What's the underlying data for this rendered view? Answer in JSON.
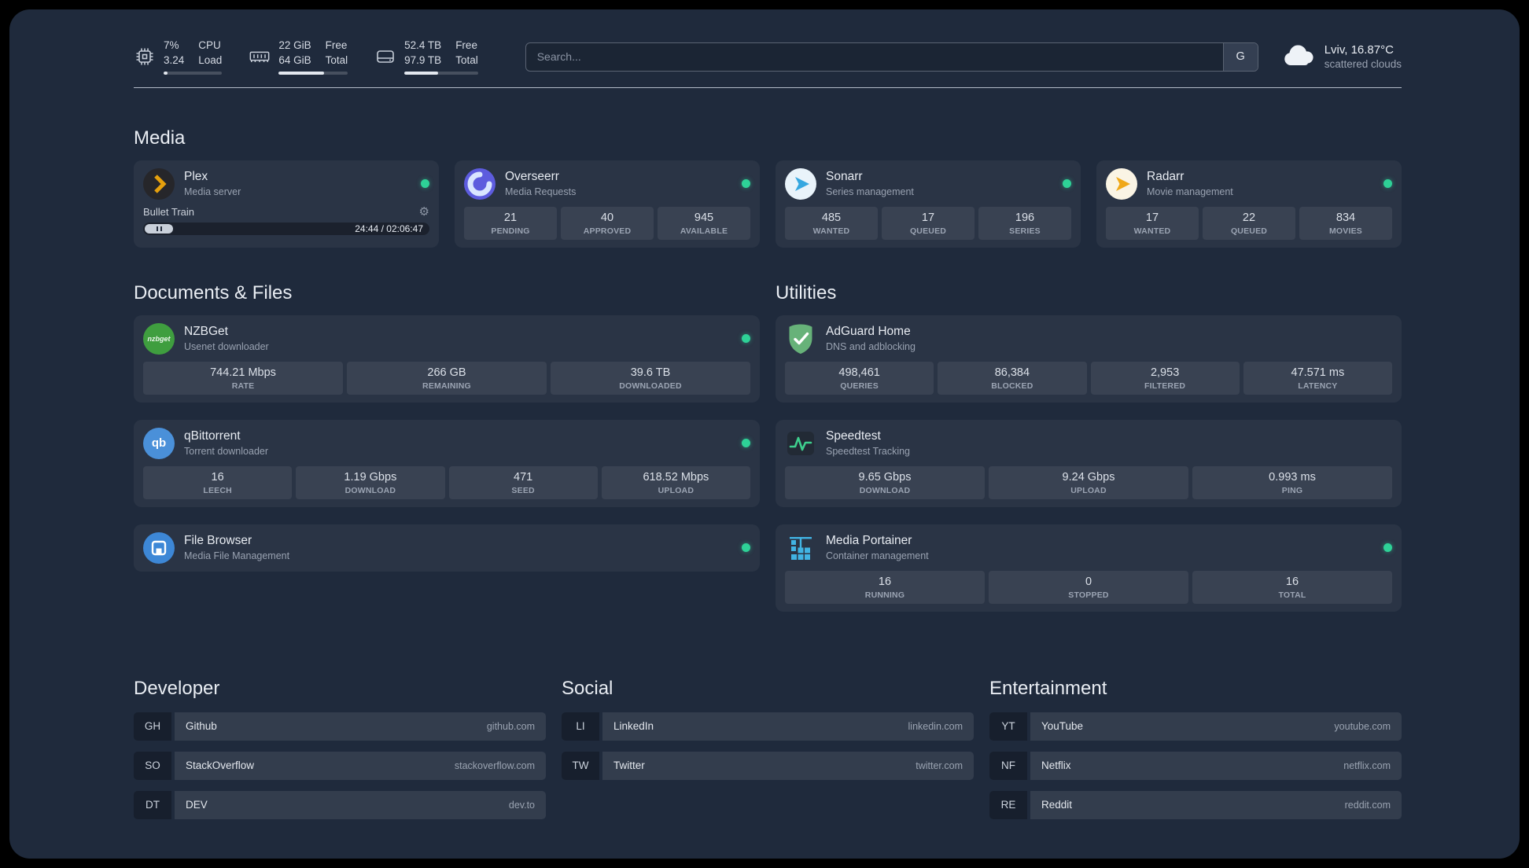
{
  "colors": {
    "background": "#1f2a3c",
    "status_online": "#2ed197",
    "plex_amber": "#e5a00d",
    "overseerr_purple": "#5d5cde",
    "sonarr_blue": "#35a7e0",
    "radarr_amber": "#f7b500",
    "nzbget_green": "#3f9e3f",
    "qbittorrent_blue": "#4a90d9",
    "adguard_green": "#67b279",
    "speedtest_green": "#3ecf8e",
    "filebrowser_blue": "#3d87d6",
    "portainer_blue": "#41b3e3"
  },
  "topbar": {
    "resources": [
      {
        "icon": "cpu-icon",
        "values": [
          "7%",
          "3.24"
        ],
        "labels": [
          "CPU",
          "Load"
        ],
        "bar_width": "7%"
      },
      {
        "icon": "memory-icon",
        "values": [
          "22 GiB",
          "64 GiB"
        ],
        "labels": [
          "Free",
          "Total"
        ],
        "bar_width": "66%"
      },
      {
        "icon": "disk-icon",
        "values": [
          "52.4 TB",
          "97.9 TB"
        ],
        "labels": [
          "Free",
          "Total"
        ],
        "bar_width": "46%"
      }
    ],
    "search": {
      "placeholder": "Search...",
      "provider_button": "G"
    },
    "weather": {
      "location": "Lviv, 16.87°C",
      "condition": "scattered clouds"
    }
  },
  "sections": {
    "media": {
      "title": "Media",
      "services": [
        {
          "name": "Plex",
          "description": "Media server",
          "icon": "plex-icon",
          "status": "online",
          "player": {
            "track": "Bullet Train",
            "time": "24:44 / 02:06:47"
          }
        },
        {
          "name": "Overseerr",
          "description": "Media Requests",
          "icon": "overseerr-icon",
          "status": "online",
          "stats": [
            {
              "value": "21",
              "label": "PENDING"
            },
            {
              "value": "40",
              "label": "APPROVED"
            },
            {
              "value": "945",
              "label": "AVAILABLE"
            }
          ]
        },
        {
          "name": "Sonarr",
          "description": "Series management",
          "icon": "sonarr-icon",
          "status": "online",
          "stats": [
            {
              "value": "485",
              "label": "WANTED"
            },
            {
              "value": "17",
              "label": "QUEUED"
            },
            {
              "value": "196",
              "label": "SERIES"
            }
          ]
        },
        {
          "name": "Radarr",
          "description": "Movie management",
          "icon": "radarr-icon",
          "status": "online",
          "stats": [
            {
              "value": "17",
              "label": "WANTED"
            },
            {
              "value": "22",
              "label": "QUEUED"
            },
            {
              "value": "834",
              "label": "MOVIES"
            }
          ]
        }
      ]
    },
    "documents": {
      "title": "Documents & Files",
      "services": [
        {
          "name": "NZBGet",
          "description": "Usenet downloader",
          "icon": "nzbget-icon",
          "status": "online",
          "stats": [
            {
              "value": "744.21 Mbps",
              "label": "RATE"
            },
            {
              "value": "266 GB",
              "label": "REMAINING"
            },
            {
              "value": "39.6 TB",
              "label": "DOWNLOADED"
            }
          ]
        },
        {
          "name": "qBittorrent",
          "description": "Torrent downloader",
          "icon": "qbittorrent-icon",
          "status": "online",
          "stats": [
            {
              "value": "16",
              "label": "LEECH"
            },
            {
              "value": "1.19 Gbps",
              "label": "DOWNLOAD"
            },
            {
              "value": "471",
              "label": "SEED"
            },
            {
              "value": "618.52 Mbps",
              "label": "UPLOAD"
            }
          ]
        },
        {
          "name": "File Browser",
          "description": "Media File Management",
          "icon": "filebrowser-icon",
          "status": "online"
        }
      ]
    },
    "utilities": {
      "title": "Utilities",
      "services": [
        {
          "name": "AdGuard Home",
          "description": "DNS and adblocking",
          "icon": "adguard-icon",
          "stats": [
            {
              "value": "498,461",
              "label": "QUERIES"
            },
            {
              "value": "86,384",
              "label": "BLOCKED"
            },
            {
              "value": "2,953",
              "label": "FILTERED"
            },
            {
              "value": "47.571 ms",
              "label": "LATENCY"
            }
          ]
        },
        {
          "name": "Speedtest",
          "description": "Speedtest Tracking",
          "icon": "speedtest-icon",
          "stats": [
            {
              "value": "9.65 Gbps",
              "label": "DOWNLOAD"
            },
            {
              "value": "9.24 Gbps",
              "label": "UPLOAD"
            },
            {
              "value": "0.993 ms",
              "label": "PING"
            }
          ]
        },
        {
          "name": "Media Portainer",
          "description": "Container management",
          "icon": "portainer-icon",
          "status": "online",
          "stats": [
            {
              "value": "16",
              "label": "RUNNING"
            },
            {
              "value": "0",
              "label": "STOPPED"
            },
            {
              "value": "16",
              "label": "TOTAL"
            }
          ]
        }
      ]
    }
  },
  "bookmarks": {
    "developer": {
      "title": "Developer",
      "items": [
        {
          "abbr": "GH",
          "name": "Github",
          "domain": "github.com"
        },
        {
          "abbr": "SO",
          "name": "StackOverflow",
          "domain": "stackoverflow.com"
        },
        {
          "abbr": "DT",
          "name": "DEV",
          "domain": "dev.to"
        }
      ]
    },
    "social": {
      "title": "Social",
      "items": [
        {
          "abbr": "LI",
          "name": "LinkedIn",
          "domain": "linkedin.com"
        },
        {
          "abbr": "TW",
          "name": "Twitter",
          "domain": "twitter.com"
        }
      ]
    },
    "entertainment": {
      "title": "Entertainment",
      "items": [
        {
          "abbr": "YT",
          "name": "YouTube",
          "domain": "youtube.com"
        },
        {
          "abbr": "NF",
          "name": "Netflix",
          "domain": "netflix.com"
        },
        {
          "abbr": "RE",
          "name": "Reddit",
          "domain": "reddit.com"
        }
      ]
    }
  }
}
